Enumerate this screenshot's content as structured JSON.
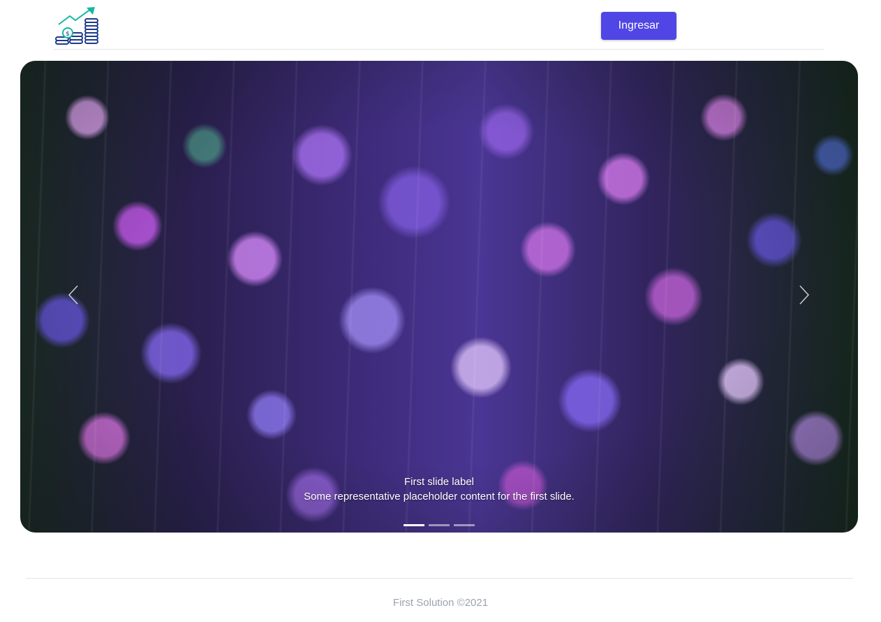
{
  "header": {
    "logo_icon": "coins-growth-logo-icon",
    "login_label": "Ingresar",
    "login_color": "#4f46e5"
  },
  "carousel": {
    "prev_icon": "chevron-left-icon",
    "next_icon": "chevron-right-icon",
    "slides": [
      {
        "title": "First slide label",
        "text": "Some representative placeholder content for the first slide."
      }
    ],
    "active_index": 0,
    "indicator_count": 3
  },
  "footer": {
    "copyright": "First Solution ©2021"
  }
}
